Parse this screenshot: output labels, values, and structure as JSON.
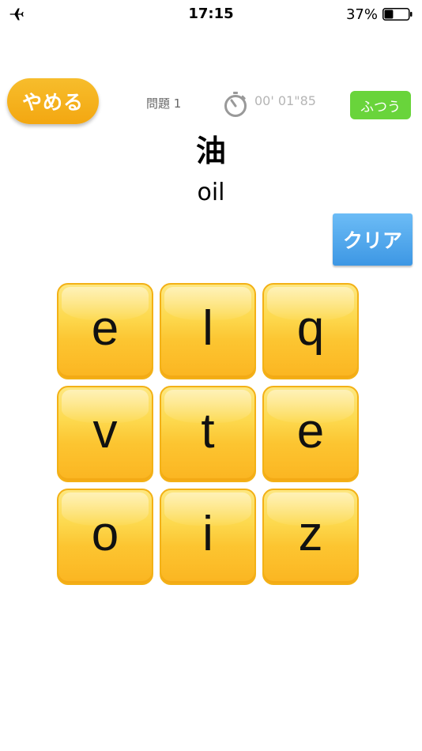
{
  "status_bar": {
    "time": "17:15",
    "battery_percent": "37%",
    "battery_level": 0.37,
    "airplane_icon": "airplane-icon",
    "battery_icon": "battery-icon"
  },
  "header": {
    "quit_label": "やめる",
    "question_label": "問題 1",
    "timer": "00' 01\"85",
    "stopwatch_icon": "stopwatch-icon",
    "difficulty": "ふつう"
  },
  "word": {
    "kanji": "油",
    "english": "oil"
  },
  "clear_label": "クリア",
  "colors": {
    "quit_button": "#f3a711",
    "difficulty_badge": "#69d43b",
    "clear_button": "#3d97e4",
    "tile": "#fcc531"
  },
  "letters": [
    "e",
    "l",
    "q",
    "v",
    "t",
    "e",
    "o",
    "i",
    "z"
  ]
}
